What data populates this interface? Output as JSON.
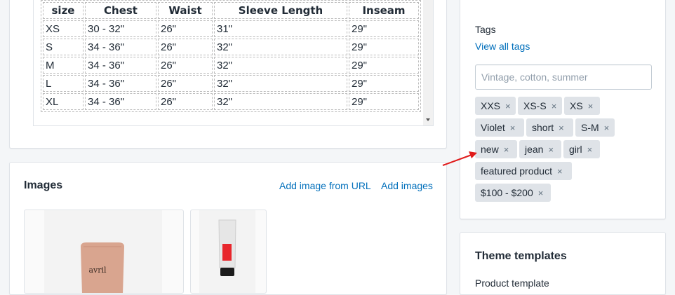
{
  "size_chart": {
    "headers": [
      "size",
      "Chest",
      "Waist",
      "Sleeve Length",
      "Inseam"
    ],
    "rows": [
      [
        "XS",
        "30 - 32\"",
        "26\"",
        "31\"",
        "29\""
      ],
      [
        "S",
        "34 - 36\"",
        "26\"",
        "32\"",
        "29\""
      ],
      [
        "M",
        "34 - 36\"",
        "26\"",
        "32\"",
        "29\""
      ],
      [
        "L",
        "34 - 36\"",
        "26\"",
        "32\"",
        "29\""
      ],
      [
        "XL",
        "34 - 36\"",
        "26\"",
        "32\"",
        "29\""
      ]
    ]
  },
  "images": {
    "title": "Images",
    "add_from_url": "Add image from URL",
    "add_images": "Add images",
    "product1_logo": "avril"
  },
  "tags": {
    "label": "Tags",
    "view_all": "View all tags",
    "input_placeholder": "Vintage, cotton, summer",
    "items": [
      "XXS",
      "XS-S",
      "XS",
      "Violet",
      "short",
      "S-M",
      "new",
      "jean",
      "girl",
      "featured product",
      "$100 - $200"
    ],
    "remove_glyph": "×"
  },
  "theme_templates": {
    "title": "Theme templates",
    "subtitle": "Product template"
  },
  "colors": {
    "link": "#006fbb",
    "tag_bg": "#dfe3e8",
    "annotation_arrow": "#e01b1b"
  }
}
